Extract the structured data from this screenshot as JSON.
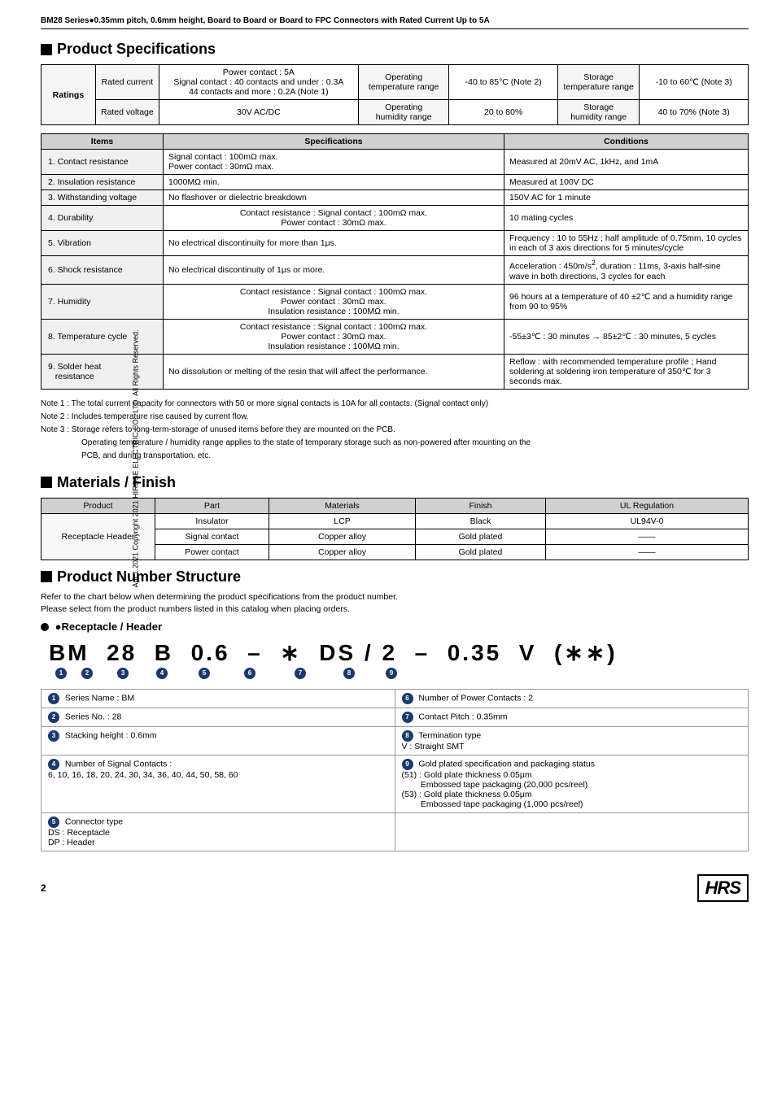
{
  "header": {
    "title": "BM28 Series●0.35mm pitch, 0.6mm height, Board to Board or Board to FPC Connectors with Rated Current Up to 5A"
  },
  "sidebar": {
    "text": "Apr.1.2021 Copyright 2021 HIROSE ELECTRIC CO., LTD. All Rights Reserved."
  },
  "product_specs": {
    "section_title": "Product Specifications",
    "ratings": {
      "rows": [
        {
          "label": "Rated current",
          "power_contact": "Power contact : 5A",
          "signal_contact": "Signal contact : 40 contacts and under : 0.3A",
          "signal_contact2": "44 contacts and more  : 0.2A (Note 1)",
          "op_temp_label": "Operating temperature range",
          "op_temp_val": "-40 to 85°C (Note 2)",
          "stor_temp_label": "Storage temperature range",
          "stor_temp_val": "-10 to 60℃ (Note 3)"
        },
        {
          "label": "Rated voltage",
          "val": "30V AC/DC",
          "op_hum_label": "Operating humidity range",
          "op_hum_val": "20 to 80%",
          "stor_hum_label": "Storage humidity range",
          "stor_hum_val": "40 to 70% (Note 3)"
        }
      ]
    },
    "specs_headers": [
      "Items",
      "Specifications",
      "Conditions"
    ],
    "specs_rows": [
      {
        "item": "1. Contact resistance",
        "spec": "Signal contact : 100mΩ max.\nPower contact : 30mΩ max.",
        "cond": "Measured at 20mV AC, 1kHz, and 1mA"
      },
      {
        "item": "2. Insulation resistance",
        "spec": "1000MΩ min.",
        "cond": "Measured at 100V DC"
      },
      {
        "item": "3. Withstanding voltage",
        "spec": "No flashover or dielectric breakdown",
        "cond": "150V AC for 1 minute"
      },
      {
        "item": "4. Durability",
        "spec": "Contact resistance : Signal contact : 100mΩ max.\nPower contact : 30mΩ max.",
        "cond": "10 mating cycles"
      },
      {
        "item": "5. Vibration",
        "spec": "No electrical discontinuity for more than 1μs.",
        "cond": "Frequency : 10 to 55Hz ; half amplitude of 0.75mm, 10 cycles in each of 3 axis directions for 5 minutes/cycle"
      },
      {
        "item": "6. Shock resistance",
        "spec": "No electrical discontinuity of 1μs or more.",
        "cond": "Acceleration : 450m/s², duration : 11ms, 3-axis half-sine wave in both directions, 3 cycles for each"
      },
      {
        "item": "7. Humidity",
        "spec": "Contact resistance : Signal contact : 100mΩ max.\nPower contact : 30mΩ max.\nInsulation resistance : 100MΩ min.",
        "cond": "96 hours at a temperature of 40 ±2℃ and a humidity range from 90 to 95%"
      },
      {
        "item": "8. Temperature cycle",
        "spec": "Contact resistance : Signal contact : 100mΩ max.\nPower contact : 30mΩ max.\nInsulation resistance : 100MΩ min.",
        "cond": "-55±3℃ : 30 minutes → 85±2℃ : 30 minutes, 5 cycles"
      },
      {
        "item": "9. Solder heat resistance",
        "spec": "No dissolution or melting of the resin that will affect the performance.",
        "cond": "Reflow : with recommended temperature profile ; Hand soldering at soldering iron temperature of 350℃ for 3 seconds max."
      }
    ],
    "notes": [
      "Note 1 : The total current capacity for connectors with 50 or more signal contacts is 10A for all contacts. (Signal contact only)",
      "Note 2 : Includes temperature rise caused by current flow.",
      "Note 3 : Storage refers to long-term-storage of unused items before they are mounted on the PCB.",
      "          Operating temperature / humidity range applies to the state of temporary storage such as non-powered after mounting on the",
      "          PCB, and during transportation, etc."
    ]
  },
  "materials_finish": {
    "section_title": "Materials / Finish",
    "headers": [
      "Product",
      "Part",
      "Materials",
      "Finish",
      "UL Regulation"
    ],
    "product": "Receptacle Header",
    "rows": [
      {
        "part": "Insulator",
        "materials": "LCP",
        "finish": "Black",
        "ul": "UL94V-0"
      },
      {
        "part": "Signal contact",
        "materials": "Copper alloy",
        "finish": "Gold plated",
        "ul": "——"
      },
      {
        "part": "Power contact",
        "materials": "Copper alloy",
        "finish": "Gold plated",
        "ul": "——"
      }
    ]
  },
  "product_number": {
    "section_title": "Product Number Structure",
    "intro1": "Refer to the chart below when determining the product specifications from the product number.",
    "intro2": "Please select from the product numbers listed in this catalog when placing orders.",
    "receptacle_header": "●Receptacle / Header",
    "part_number": "BM 28 B 0.6 – * DS / 2 – 0.35 V (**)",
    "circles": [
      "①",
      "②",
      "③",
      "④",
      "⑤",
      "⑥",
      "⑦",
      "⑧",
      "⑨"
    ],
    "legend": [
      {
        "num": "①",
        "label": "Series Name : BM",
        "num2": "⑥",
        "label2": "Number of Power Contacts : 2"
      },
      {
        "num": "②",
        "label": "Series No. : 28",
        "num2": "⑦",
        "label2": "Contact Pitch : 0.35mm"
      },
      {
        "num": "③",
        "label": "Stacking height : 0.6mm",
        "num2": "⑧",
        "label2": "Termination type\nV : Straight SMT"
      },
      {
        "num": "④",
        "label": "Number of Signal Contacts :\n6, 10, 16, 18, 20, 24, 30, 34, 36, 40, 44, 50, 58, 60",
        "num2": "⑨",
        "label2": "Gold plated specification and packaging status\n(51) : Gold plate thickness 0.05μm\n        Embossed tape packaging (20,000 pcs/reel)\n(53) : Gold plate thickness 0.05μm\n        Embossed tape packaging (1,000 pcs/reel)"
      },
      {
        "num": "⑤",
        "label": "Connector type\nDS : Receptacle\nDP : Header",
        "num2": "",
        "label2": ""
      }
    ]
  },
  "footer": {
    "page_num": "2",
    "logo": "HRS"
  }
}
